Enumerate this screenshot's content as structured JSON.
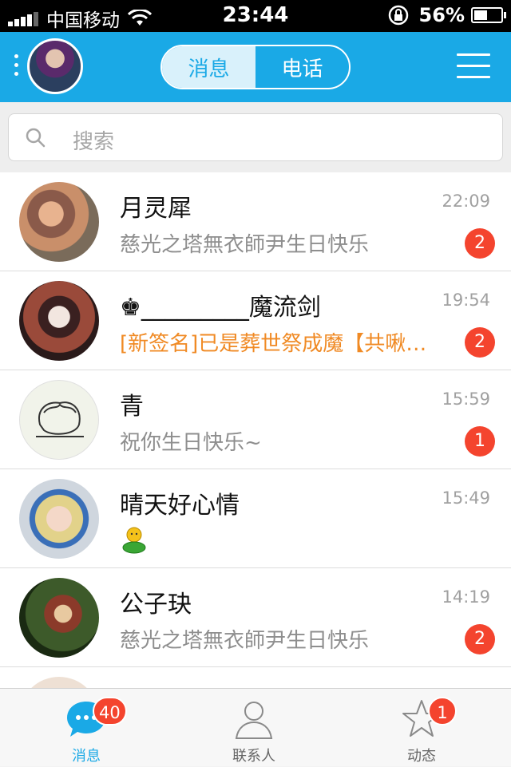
{
  "status_bar": {
    "carrier": "中国移动",
    "time": "23:44",
    "battery": "56%",
    "battery_level": 0.56
  },
  "header": {
    "tabs": [
      {
        "label": "消息",
        "active": true
      },
      {
        "label": "电话",
        "active": false
      }
    ],
    "accent_color": "#1aa9e6"
  },
  "search": {
    "placeholder": "搜索"
  },
  "conversations": [
    {
      "name": "月灵犀",
      "time": "22:09",
      "message": "慈光之塔無衣師尹生日快乐",
      "unread": "2",
      "message_color": "gray"
    },
    {
      "name": "♚_________魔流剑",
      "time": "19:54",
      "message": "[新签名]已是葬世祭成魔【共啾…",
      "unread": "2",
      "message_color": "orange"
    },
    {
      "name": "青",
      "time": "15:59",
      "message": "祝你生日快乐~",
      "unread": "1",
      "message_color": "gray"
    },
    {
      "name": "晴天好心情",
      "time": "15:49",
      "message": "",
      "unread": "",
      "message_icon": "smiley-emoji-icon"
    },
    {
      "name": "公子玦",
      "time": "14:19",
      "message": "慈光之塔無衣師尹生日快乐",
      "unread": "2",
      "message_color": "gray"
    }
  ],
  "tabbar": {
    "items": [
      {
        "label": "消息",
        "badge": "40",
        "icon": "chat-bubble-icon",
        "active": true
      },
      {
        "label": "联系人",
        "badge": "",
        "icon": "contact-person-icon",
        "active": false
      },
      {
        "label": "动态",
        "badge": "1",
        "icon": "star-icon",
        "active": false
      }
    ]
  }
}
